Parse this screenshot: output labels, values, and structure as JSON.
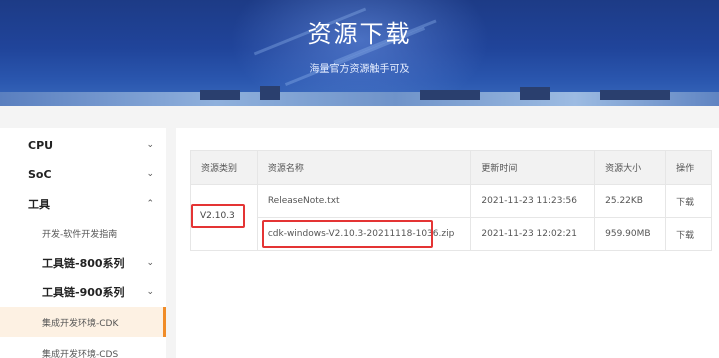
{
  "banner": {
    "title": "资源下载",
    "subtitle": "海量官方资源触手可及"
  },
  "sidebar": {
    "items": [
      {
        "label": "CPU",
        "chevron": "chevron-down"
      },
      {
        "label": "SoC",
        "chevron": "chevron-down"
      },
      {
        "label": "工具",
        "chevron": "chevron-up"
      },
      {
        "label": "开发-软件开发指南"
      },
      {
        "label": "工具链-800系列",
        "chevron": "chevron-down"
      },
      {
        "label": "工具链-900系列",
        "chevron": "chevron-down"
      },
      {
        "label": "集成开发环境-CDK",
        "active": true
      },
      {
        "label": "集成开发环境-CDS"
      }
    ],
    "chevron_down_glyph": "⌄",
    "chevron_up_glyph": "⌃"
  },
  "table": {
    "headers": [
      "资源类别",
      "资源名称",
      "更新时间",
      "资源大小",
      "操作"
    ],
    "type_value": "V2.10.3",
    "rows": [
      {
        "name": "ReleaseNote.txt",
        "time": "2021-11-23 11:23:56",
        "size": "25.22KB",
        "action": "下载"
      },
      {
        "name": "cdk-windows-V2.10.3-20211118-1036.zip",
        "time": "2021-11-23 12:02:21",
        "size": "959.90MB",
        "action": "下载"
      }
    ]
  },
  "colors": {
    "accent": "#f08c28",
    "highlight_box": "#e43434",
    "banner": "#20449a"
  }
}
